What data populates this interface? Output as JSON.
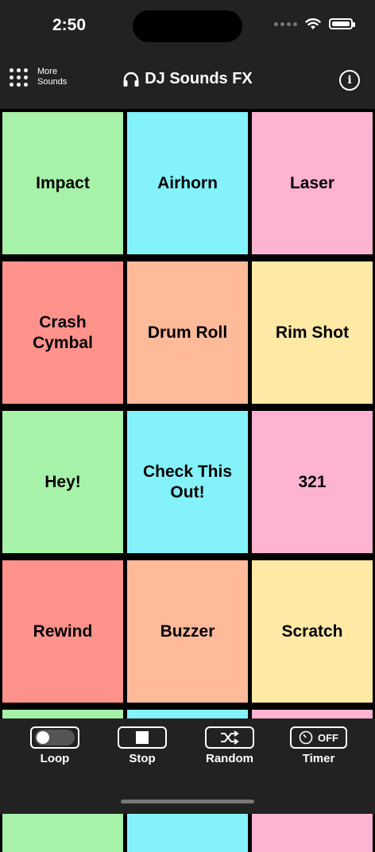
{
  "status": {
    "time": "2:50"
  },
  "header": {
    "more_line1": "More",
    "more_line2": "Sounds",
    "title": "DJ Sounds FX",
    "info": "i"
  },
  "pads": [
    {
      "label": "Impact",
      "color": "#a6f2a9"
    },
    {
      "label": "Airhorn",
      "color": "#83f2fb"
    },
    {
      "label": "Laser",
      "color": "#ffb3d3"
    },
    {
      "label": "Crash Cymbal",
      "color": "#ff938c"
    },
    {
      "label": "Drum Roll",
      "color": "#ffba9a"
    },
    {
      "label": "Rim Shot",
      "color": "#ffe9a4"
    },
    {
      "label": "Hey!",
      "color": "#a6f2a9"
    },
    {
      "label": "Check This Out!",
      "color": "#83f2fb"
    },
    {
      "label": "321",
      "color": "#ffb3d3"
    },
    {
      "label": "Rewind",
      "color": "#ff938c"
    },
    {
      "label": "Buzzer",
      "color": "#ffba9a"
    },
    {
      "label": "Scratch",
      "color": "#ffe9a4"
    },
    {
      "label": "",
      "color": "#a6f2a9"
    },
    {
      "label": "",
      "color": "#83f2fb"
    },
    {
      "label": "",
      "color": "#ffb3d3"
    }
  ],
  "controls": {
    "loop": "Loop",
    "stop": "Stop",
    "random": "Random",
    "timer": "Timer",
    "timer_state": "OFF"
  }
}
